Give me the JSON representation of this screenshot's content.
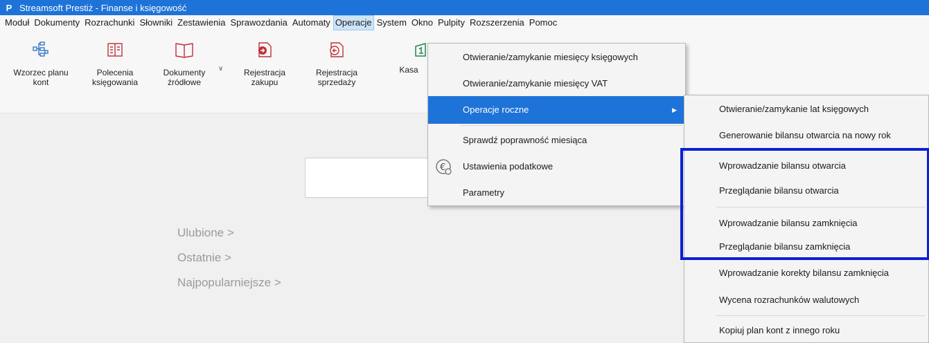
{
  "window": {
    "title": "Streamsoft Prestiż - Finanse i księgowość",
    "logo": "P"
  },
  "menubar": [
    "Moduł",
    "Dokumenty",
    "Rozrachunki",
    "Słowniki",
    "Zestawienia",
    "Sprawozdania",
    "Automaty",
    "Operacje",
    "System",
    "Okno",
    "Pulpity",
    "Rozszerzenia",
    "Pomoc"
  ],
  "ribbon": {
    "buttons": [
      {
        "line1": "Wzorzec planu",
        "line2": "kont",
        "icon": "chart-of-accounts-icon"
      },
      {
        "line1": "Polecenia",
        "line2": "księgowania",
        "icon": "ledger-book-icon"
      },
      {
        "line1": "Dokumenty",
        "line2": "źródłowe",
        "icon": "open-book-icon"
      },
      {
        "line1": "Rejestracja",
        "line2": "zakupu",
        "icon": "purchase-register-icon"
      },
      {
        "line1": "Rejestracja",
        "line2": "sprzedaży",
        "icon": "sales-register-icon"
      },
      {
        "line1": "Kasa",
        "line2": "",
        "icon": "cash-register-icon"
      }
    ]
  },
  "workspace": {
    "links": [
      "Ulubione  >",
      "Ostatnie  >",
      "Najpopularniejsze  >"
    ]
  },
  "operacje_menu": [
    "Otwieranie/zamykanie miesięcy księgowych",
    "Otwieranie/zamykanie miesięcy VAT",
    "Operacje roczne",
    "Sprawdź poprawność miesiąca",
    "Ustawienia podatkowe",
    "Parametry"
  ],
  "roczne_submenu": [
    "Otwieranie/zamykanie lat księgowych",
    "Generowanie bilansu otwarcia na nowy rok",
    "Wprowadzanie bilansu otwarcia",
    "Przeglądanie bilansu otwarcia",
    "Wprowadzanie bilansu zamknięcia",
    "Przeglądanie bilansu zamknięcia",
    "Wprowadzanie korekty bilansu zamknięcia",
    "Wycena rozrachunków walutowych",
    "Kopiuj plan kont z innego roku"
  ],
  "colors": {
    "titlebar": "#1e73d8",
    "highlight": "#1e73d8",
    "annotation_frame": "#0a1fd6",
    "menu_active": "#cde4f7"
  }
}
